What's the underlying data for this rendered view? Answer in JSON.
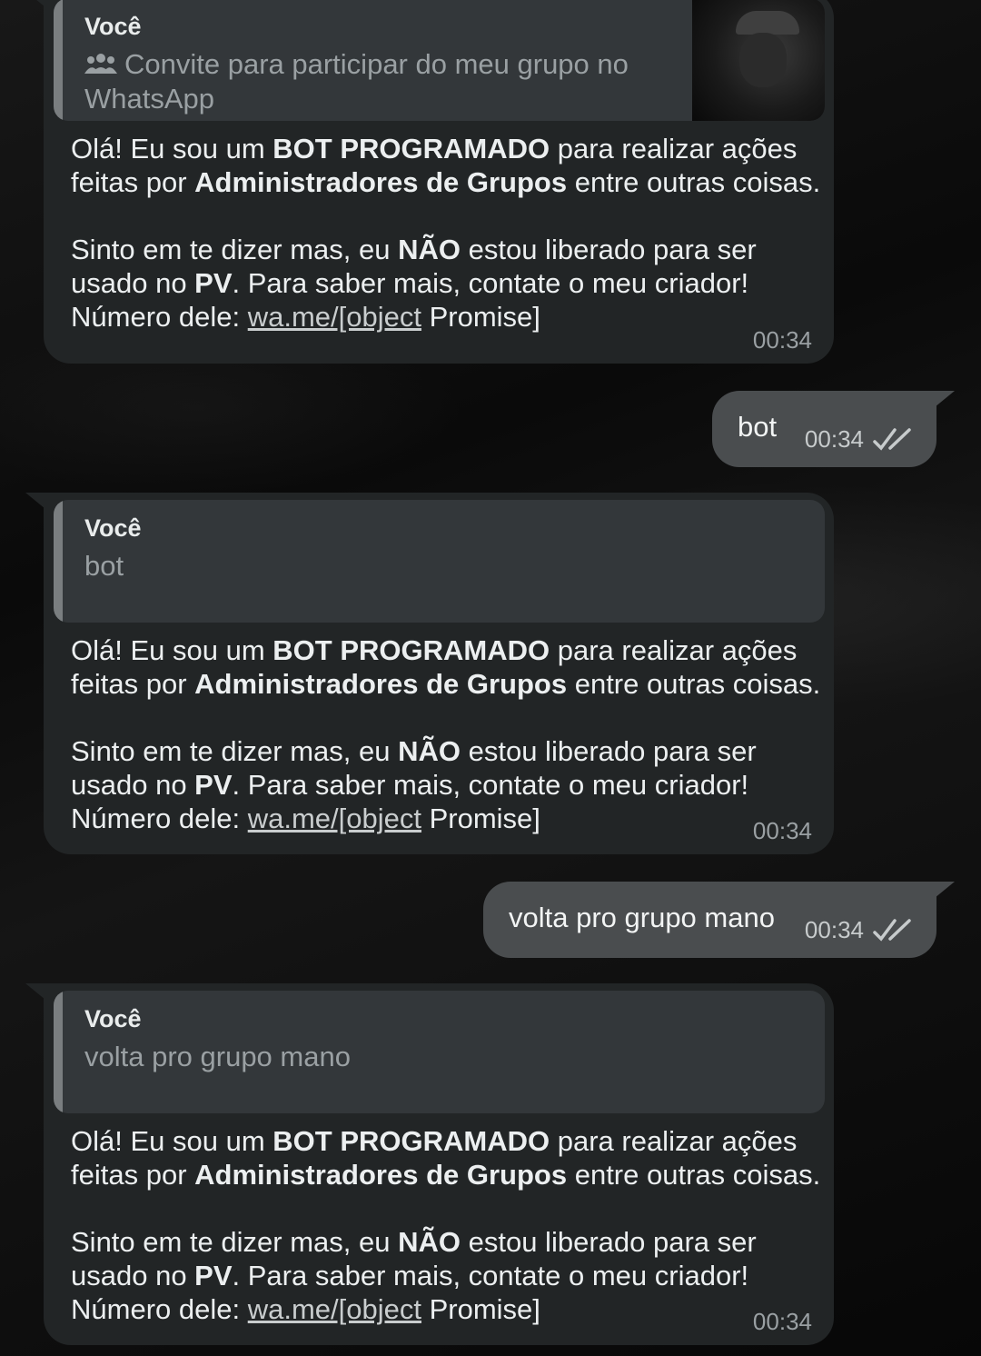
{
  "messages": [
    {
      "type": "incoming",
      "quote": {
        "author": "Você",
        "text": "Convite para participar do meu grupo no WhatsApp",
        "icon": "group-icon",
        "has_thumbnail": true
      },
      "body": {
        "l1a": "Olá! Eu sou um ",
        "l1b": "BOT PROGRAMADO",
        "l1c": " para realizar ações feitas por ",
        "l1d": "Administradores de Grupos",
        "l1e": " entre outras coisas.",
        "l2a": "Sinto em te dizer mas, eu ",
        "l2b": "NÃO",
        "l2c": " estou liberado para ser usado no ",
        "l2d": "PV",
        "l2e": ". Para saber mais, contate o meu criador! Número dele: ",
        "link": "wa.me/[object",
        "l2f": " Promise]"
      },
      "time": "00:34"
    },
    {
      "type": "outgoing",
      "text": "bot",
      "time": "00:34",
      "status": "read-double-check"
    },
    {
      "type": "incoming",
      "quote": {
        "author": "Você",
        "text": "bot"
      },
      "body": {
        "l1a": "Olá! Eu sou um ",
        "l1b": "BOT PROGRAMADO",
        "l1c": " para realizar ações feitas por ",
        "l1d": "Administradores de Grupos",
        "l1e": " entre outras coisas.",
        "l2a": "Sinto em te dizer mas, eu ",
        "l2b": "NÃO",
        "l2c": " estou liberado para ser usado no ",
        "l2d": "PV",
        "l2e": ". Para saber mais, contate o meu criador! Número dele: ",
        "link": "wa.me/[object",
        "l2f": " Promise]"
      },
      "time": "00:34"
    },
    {
      "type": "outgoing",
      "text": "volta pro grupo mano",
      "time": "00:34",
      "status": "read-double-check"
    },
    {
      "type": "incoming",
      "quote": {
        "author": "Você",
        "text": "volta pro grupo mano"
      },
      "body": {
        "l1a": "Olá! Eu sou um ",
        "l1b": "BOT PROGRAMADO",
        "l1c": " para realizar ações feitas por ",
        "l1d": "Administradores de Grupos",
        "l1e": " entre outras coisas.",
        "l2a": "Sinto em te dizer mas, eu ",
        "l2b": "NÃO",
        "l2c": " estou liberado para ser usado no ",
        "l2d": "PV",
        "l2e": ". Para saber mais, contate o meu criador! Número dele: ",
        "link": "wa.me/[object",
        "l2f": " Promise]"
      },
      "time": "00:34"
    }
  ],
  "colors": {
    "incoming_bubble": "#222526",
    "outgoing_bubble": "#4a4d4f",
    "quote_bg": "#33373a",
    "time": "#9aa0a3"
  }
}
